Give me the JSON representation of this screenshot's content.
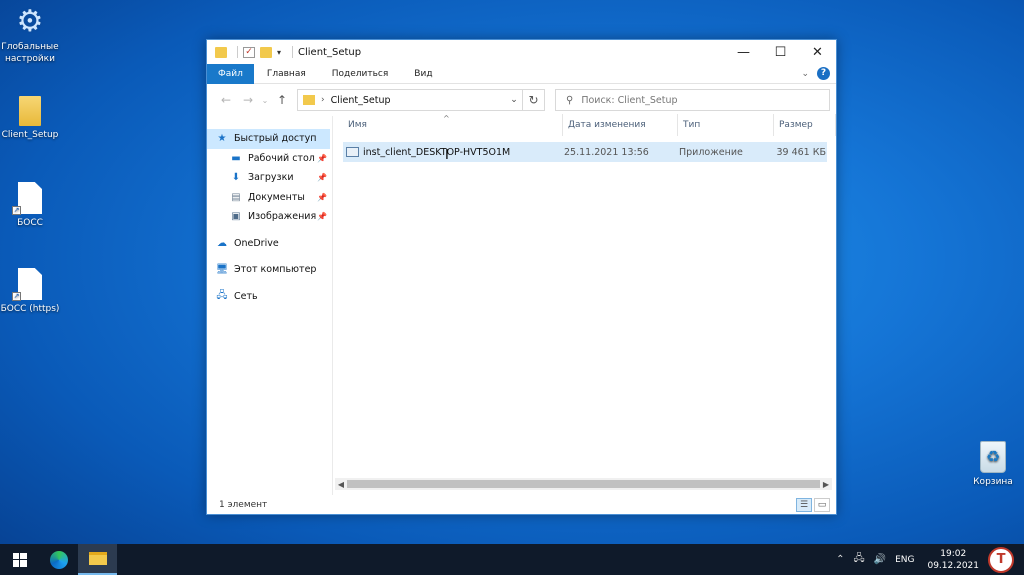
{
  "desktop": {
    "icons": [
      {
        "label": "Глобальные настройки",
        "icon": "gear-icon"
      },
      {
        "label": "Client_Setup",
        "icon": "folder-icon"
      },
      {
        "label": "БОСС",
        "icon": "shortcut-file-icon"
      },
      {
        "label": "БОСС (https)",
        "icon": "shortcut-file-icon"
      },
      {
        "label": "Корзина",
        "icon": "recycle-bin-icon"
      }
    ]
  },
  "window": {
    "title": "Client_Setup",
    "controls": {
      "minimize": "—",
      "maximize": "☐",
      "close": "✕"
    },
    "ribbon": {
      "tabs": [
        "Файл",
        "Главная",
        "Поделиться",
        "Вид"
      ],
      "expand": "⌄",
      "help": "?"
    },
    "nav": {
      "back": "←",
      "forward": "→",
      "recent": "⌄",
      "up": "↑",
      "address_sep": "›",
      "address": "Client_Setup",
      "address_dropdown": "⌄",
      "refresh": "↻",
      "search_placeholder": "Поиск: Client_Setup"
    },
    "sidebar": {
      "items": [
        {
          "label": "Быстрый доступ",
          "icon": "star-icon",
          "pinned": false
        },
        {
          "label": "Рабочий стол",
          "icon": "desktop-icon",
          "pinned": true
        },
        {
          "label": "Загрузки",
          "icon": "download-icon",
          "pinned": true
        },
        {
          "label": "Документы",
          "icon": "documents-icon",
          "pinned": true
        },
        {
          "label": "Изображения",
          "icon": "pictures-icon",
          "pinned": true
        },
        {
          "label": "OneDrive",
          "icon": "cloud-icon",
          "pinned": false
        },
        {
          "label": "Этот компьютер",
          "icon": "computer-icon",
          "pinned": false
        },
        {
          "label": "Сеть",
          "icon": "network-icon",
          "pinned": false
        }
      ]
    },
    "columns": [
      "Имя",
      "Дата изменения",
      "Тип",
      "Размер"
    ],
    "files": [
      {
        "name": "inst_client_DESKTOP-HVT5O1M",
        "modified": "25.11.2021 13:56",
        "type": "Приложение",
        "size": "39 461 КБ"
      }
    ],
    "status": "1 элемент"
  },
  "taskbar": {
    "tray": {
      "chevron": "⌃",
      "network": "🖧",
      "volume": "🔊",
      "lang": "ENG"
    },
    "time": "19:02",
    "date": "09.12.2021",
    "watermark": "T"
  },
  "colors": {
    "accent": "#1979ca",
    "selection": "#d9ebfa",
    "desktop": "#1575d6",
    "taskbar": "#0f1a2a"
  }
}
